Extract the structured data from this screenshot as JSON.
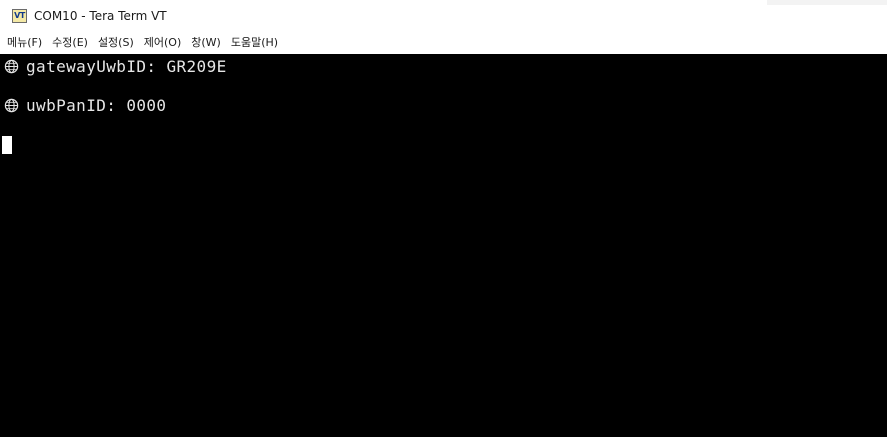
{
  "window": {
    "icon_text": "VT",
    "title": "COM10 - Tera Term VT"
  },
  "menubar": {
    "items": [
      {
        "label": "메뉴(F)"
      },
      {
        "label": "수정(E)"
      },
      {
        "label": "설정(S)"
      },
      {
        "label": "제어(O)"
      },
      {
        "label": "창(W)"
      },
      {
        "label": "도움말(H)"
      }
    ]
  },
  "terminal": {
    "lines": [
      {
        "icon": "globe-icon",
        "text": "gatewayUwbID: GR209E"
      },
      {
        "icon": "globe-icon",
        "text": "uwbPanID: 0000"
      }
    ],
    "colors": {
      "background": "#000000",
      "foreground": "#e6e6e6",
      "cursor": "#ffffff"
    }
  }
}
